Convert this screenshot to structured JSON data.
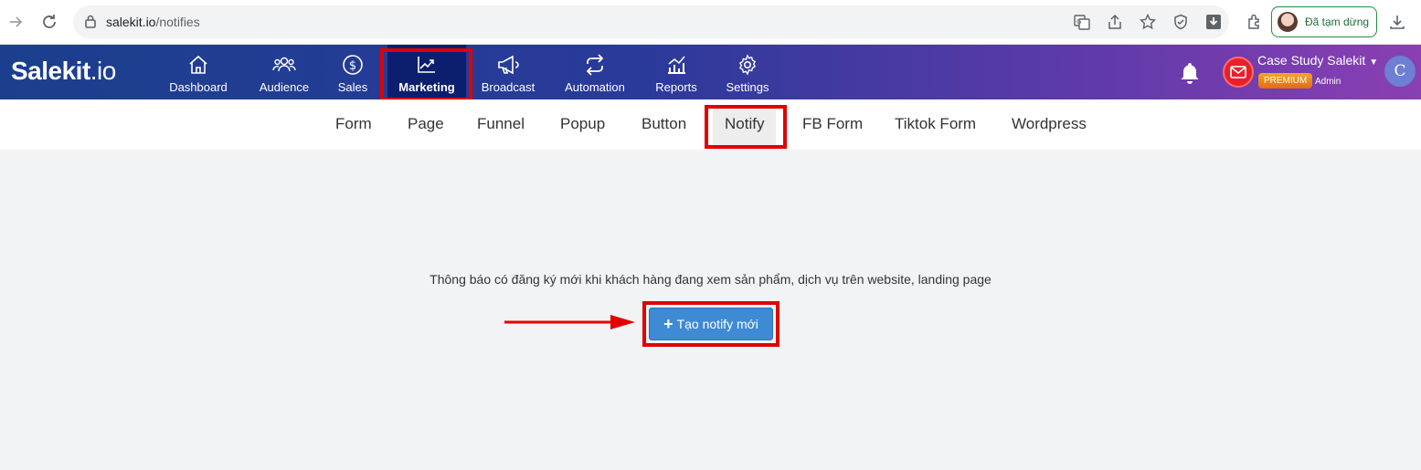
{
  "browser": {
    "url_host": "salekit.io",
    "url_path": "/notifies",
    "profile_status": "Đã tạm dừng"
  },
  "app": {
    "logo_main": "Salekit",
    "logo_suffix": ".io",
    "nav": [
      {
        "label": "Dashboard",
        "icon": "home-icon"
      },
      {
        "label": "Audience",
        "icon": "users-icon"
      },
      {
        "label": "Sales",
        "icon": "dollar-icon"
      },
      {
        "label": "Marketing",
        "icon": "trending-icon"
      },
      {
        "label": "Broadcast",
        "icon": "megaphone-icon"
      },
      {
        "label": "Automation",
        "icon": "repeat-icon"
      },
      {
        "label": "Reports",
        "icon": "chart-icon"
      },
      {
        "label": "Settings",
        "icon": "gear-icon"
      }
    ],
    "active_nav": "Marketing",
    "account": {
      "name": "Case Study Salekit",
      "plan": "PREMIUM",
      "role": "Admin",
      "avatar_letter": "C"
    }
  },
  "subnav": {
    "items": [
      "Form",
      "Page",
      "Funnel",
      "Popup",
      "Button",
      "Notify",
      "FB Form",
      "Tiktok Form",
      "Wordpress"
    ],
    "active": "Notify"
  },
  "main": {
    "description": "Thông báo có đăng ký mới khi khách hàng đang xem sản phẩm, dịch vụ trên website, landing page",
    "create_button": "Tạo notify mới"
  },
  "colors": {
    "highlight": "#e00000",
    "primary_button": "#3f8ad4",
    "header_start": "#1b3f8e",
    "header_end": "#8a3fb4"
  }
}
